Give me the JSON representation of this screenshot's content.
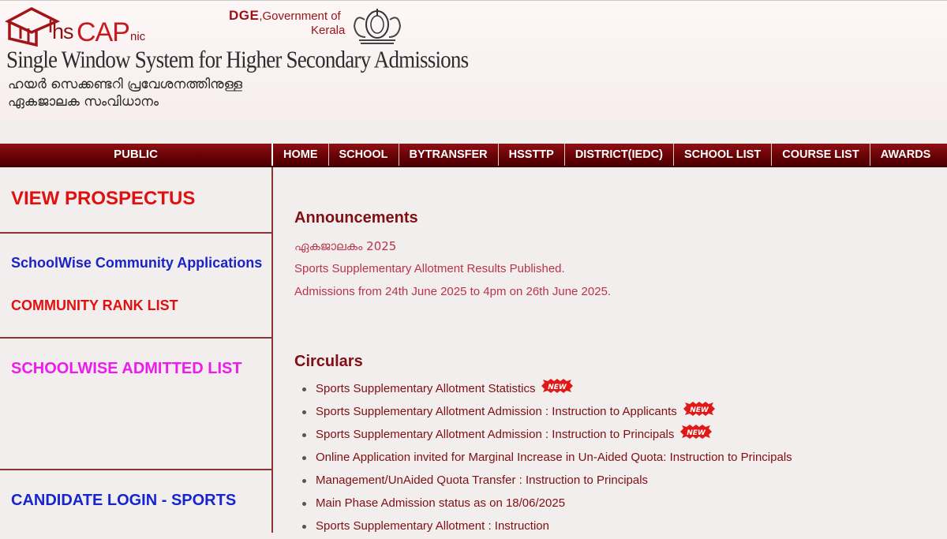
{
  "header": {
    "logo_hs": "hs",
    "logo_cap": "CAP",
    "logo_nic": "nic",
    "dge_abbr": "DGE",
    "dge_rest": ",Government of",
    "dge_line2": "Kerala",
    "system_title": "Single Window System for Higher Secondary Admissions",
    "malayalam_line1": "ഹയർ സെക്കണ്ടറി പ്രവേശനത്തിനുള്ള",
    "malayalam_line2": "ഏകജാലക സംവിധാനം"
  },
  "nav": {
    "public_label": "PUBLIC",
    "items": [
      "HOME",
      "SCHOOL",
      "BYTRANSFER",
      "HSSTTP",
      "DISTRICT(IEDC)",
      "SCHOOL LIST",
      "COURSE LIST",
      "AWARDS"
    ]
  },
  "sidebar": {
    "view_prospectus": "VIEW PROSPECTUS",
    "schoolwise_community_applications": "SchoolWise Community Applications",
    "community_rank_list": "COMMUNITY RANK LIST",
    "schoolwise_admitted_list": "SCHOOLWISE ADMITTED LIST",
    "candidate_login_sports": "CANDIDATE LOGIN - SPORTS"
  },
  "announcements": {
    "heading": "Announcements",
    "items": [
      "ഏകജാലകം 2025",
      "Sports Supplementary Allotment Results Published.",
      "Admissions from 24th June 2025 to 4pm on 26th June 2025."
    ]
  },
  "circulars": {
    "heading": "Circulars",
    "new_badge": "NEW",
    "items": [
      {
        "text": "Sports Supplementary Allotment Statistics",
        "is_new": true
      },
      {
        "text": "Sports Supplementary Allotment Admission : Instruction to Applicants",
        "is_new": true
      },
      {
        "text": "Sports Supplementary Allotment Admission : Instruction to Principals",
        "is_new": true
      },
      {
        "text": "Online Application invited for Marginal Increase in Un-Aided Quota: Instruction to Principals",
        "is_new": false
      },
      {
        "text": "Management/UnAided Quota Transfer : Instruction to Principals",
        "is_new": false
      },
      {
        "text": "Main Phase Admission status as on 18/06/2025",
        "is_new": false
      },
      {
        "text": "Sports Supplementary Allotment : Instruction",
        "is_new": false
      }
    ]
  },
  "colors": {
    "nav_bg": "#650205",
    "accent_red": "#e20f0f",
    "link_blue": "#1a23c6",
    "link_magenta": "#ee1aee",
    "heading_maroon": "#7f0f12",
    "announcement_text": "#b8344a"
  }
}
